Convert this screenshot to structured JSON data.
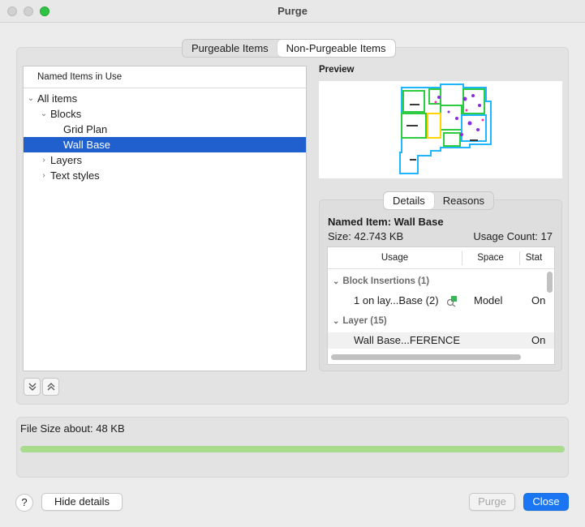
{
  "window": {
    "title": "Purge"
  },
  "tabs": [
    {
      "label": "Purgeable Items",
      "active": false
    },
    {
      "label": "Non-Purgeable Items",
      "active": true
    }
  ],
  "tree": {
    "header": "Named Items in Use",
    "items": [
      {
        "label": "All items",
        "expanded": true
      },
      {
        "label": "Blocks",
        "expanded": true
      },
      {
        "label": "Grid Plan"
      },
      {
        "label": "Wall Base",
        "selected": true
      },
      {
        "label": "Layers",
        "expanded": false
      },
      {
        "label": "Text styles",
        "expanded": false
      }
    ]
  },
  "tree_buttons": {
    "expand_all": "expand-all-icon",
    "collapse_all": "collapse-all-icon"
  },
  "preview": {
    "label": "Preview"
  },
  "details": {
    "tabs": [
      {
        "label": "Details",
        "active": true
      },
      {
        "label": "Reasons",
        "active": false
      }
    ],
    "named_item": "Named Item: Wall Base",
    "size": "Size: 42.743 KB",
    "usage_count": "Usage Count: 17",
    "table": {
      "columns": [
        "Usage",
        "Space",
        "Stat"
      ],
      "groups": [
        {
          "label": "Block Insertions (1)",
          "rows": [
            {
              "usage": "1 on lay...Base (2)",
              "space": "Model",
              "status": "On"
            }
          ]
        },
        {
          "label": "Layer (15)",
          "rows": [
            {
              "usage": "Wall Base...FERENCE",
              "space": "",
              "status": "On"
            }
          ]
        }
      ]
    }
  },
  "file_size": {
    "label": "File Size about: 48 KB",
    "progress": 1.0
  },
  "buttons": {
    "help": "?",
    "hide_details": "Hide details",
    "purge": "Purge",
    "close": "Close"
  },
  "colors": {
    "accent": "#1a76f2",
    "selection": "#1f5fce",
    "progress": "#a9dc8b"
  }
}
